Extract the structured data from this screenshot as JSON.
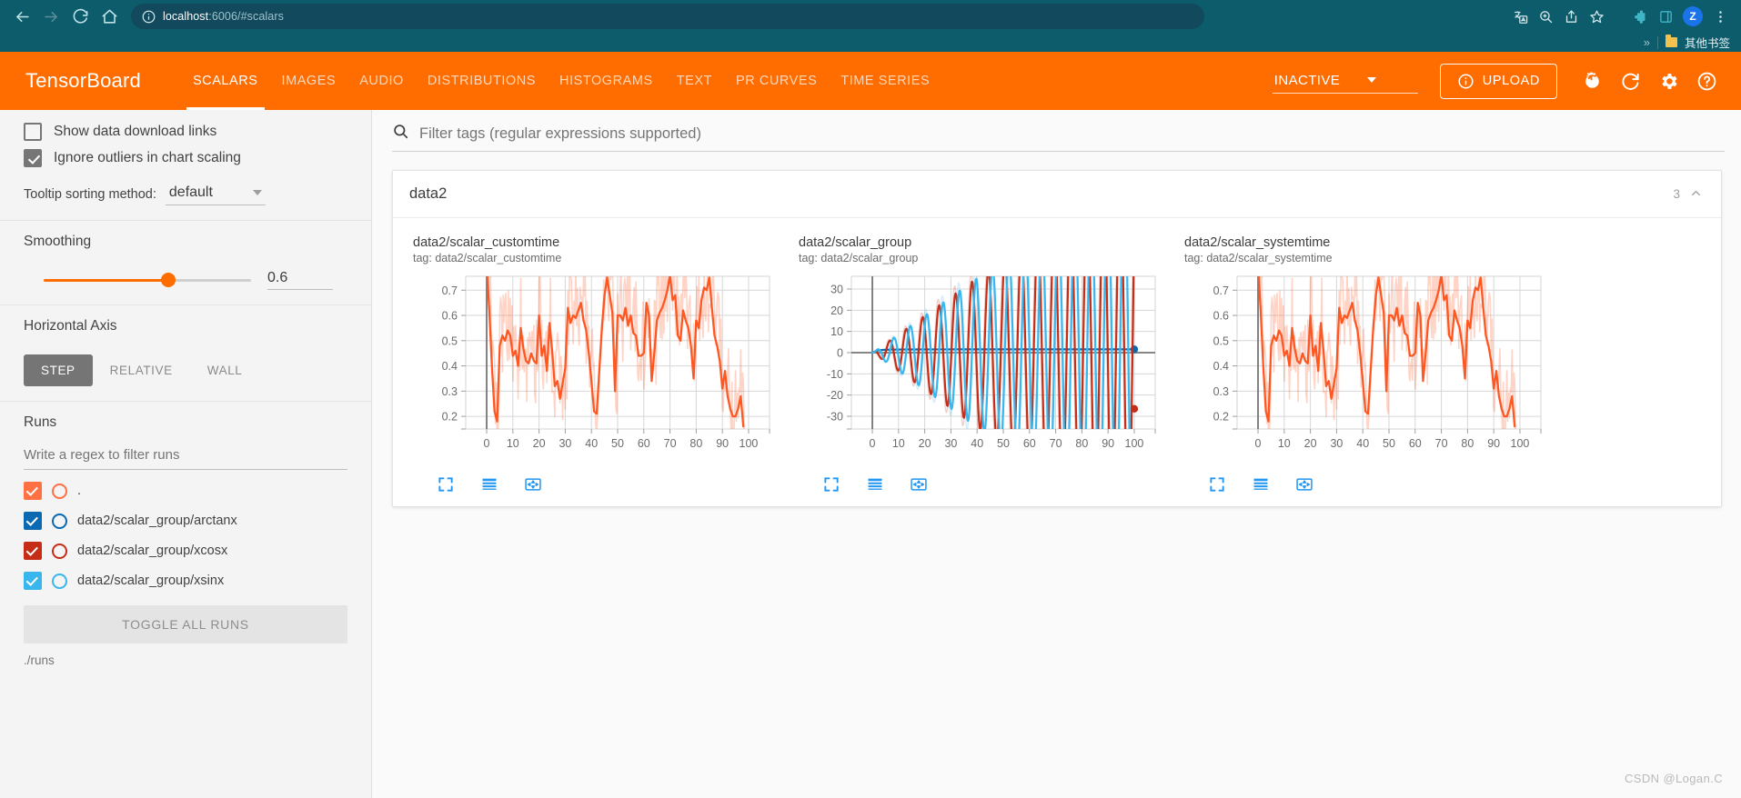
{
  "browser": {
    "url_full": "localhost:6006/#scalars",
    "url_host": "localhost",
    "url_rest": ":6006/#scalars",
    "back_icon": "back-arrow-icon",
    "forward_icon": "forward-arrow-icon",
    "reload_icon": "reload-icon",
    "home_icon": "home-icon",
    "info_icon": "site-info-icon",
    "toolbar_icons": [
      "translate-icon",
      "zoom-icon",
      "share-icon",
      "bookmark-star-icon",
      "extensions-icon",
      "side-panel-icon"
    ],
    "avatar_initial": "Z",
    "menu_icon": "three-dot-menu-icon",
    "bookmarks": {
      "overflow_label": "»",
      "folder_label": "其他书签"
    },
    "chrome_color": "#0d5c6b"
  },
  "tensorboard": {
    "logo": "TensorBoard",
    "accent_color": "#ff6d00",
    "tabs": [
      {
        "label": "SCALARS",
        "active": true
      },
      {
        "label": "IMAGES",
        "active": false
      },
      {
        "label": "AUDIO",
        "active": false
      },
      {
        "label": "DISTRIBUTIONS",
        "active": false
      },
      {
        "label": "HISTOGRAMS",
        "active": false
      },
      {
        "label": "TEXT",
        "active": false
      },
      {
        "label": "PR CURVES",
        "active": false
      },
      {
        "label": "TIME SERIES",
        "active": false
      }
    ],
    "reload_selector_value": "INACTIVE",
    "upload_label": "UPLOAD",
    "header_icons": [
      "brightness-icon",
      "refresh-icon",
      "settings-gear-icon",
      "help-question-icon"
    ]
  },
  "sidebar": {
    "show_download_links": {
      "label": "Show data download links",
      "checked": false
    },
    "ignore_outliers": {
      "label": "Ignore outliers in chart scaling",
      "checked": true
    },
    "tooltip_sorting": {
      "label": "Tooltip sorting method:",
      "value": "default"
    },
    "smoothing": {
      "label": "Smoothing",
      "value": "0.6",
      "percent": 60
    },
    "horizontal_axis": {
      "label": "Horizontal Axis",
      "options": [
        {
          "label": "STEP",
          "active": true
        },
        {
          "label": "RELATIVE",
          "active": false
        },
        {
          "label": "WALL",
          "active": false
        }
      ]
    },
    "runs": {
      "label": "Runs",
      "filter_placeholder": "Write a regex to filter runs",
      "items": [
        {
          "label": ".",
          "color": "#ff7043",
          "checked": true
        },
        {
          "label": "data2/scalar_group/arctanx",
          "color": "#0a69b0",
          "checked": true
        },
        {
          "label": "data2/scalar_group/xcosx",
          "color": "#c62d16",
          "checked": true
        },
        {
          "label": "data2/scalar_group/xsinx",
          "color": "#39b6ee",
          "checked": true
        }
      ],
      "toggle_all_label": "TOGGLE ALL RUNS",
      "path": "./runs"
    }
  },
  "main": {
    "filter_placeholder": "Filter tags (regular expressions supported)",
    "search_icon": "search-icon",
    "card": {
      "title": "data2",
      "count": "3",
      "collapse_icon": "chevron-up-icon"
    },
    "chart_action_icons": [
      "expand-chart-icon",
      "data-table-icon",
      "reset-domain-icon"
    ],
    "watermark": "CSDN @Logan.C"
  },
  "chart_data": [
    {
      "type": "line",
      "title": "data2/scalar_customtime",
      "tag": "tag: data2/scalar_customtime",
      "xlabel": "",
      "ylabel": "",
      "xlim": [
        -8,
        108
      ],
      "ylim": [
        0.15,
        0.755
      ],
      "xticks": [
        0,
        10,
        20,
        30,
        40,
        50,
        60,
        70,
        80,
        90,
        100
      ],
      "yticks": [
        0.2,
        0.3,
        0.4,
        0.5,
        0.6,
        0.7
      ],
      "grid": true,
      "legend": "none",
      "series": [
        {
          "name": ".",
          "color": "#ff5722",
          "smoothed": true,
          "x": [
            0,
            1,
            2,
            3,
            4,
            5,
            6,
            7,
            8,
            9,
            10,
            11,
            12,
            13,
            14,
            15,
            16,
            17,
            18,
            19,
            20,
            21,
            22,
            23,
            24,
            25,
            26,
            27,
            28,
            29,
            30,
            31,
            32,
            33,
            34,
            35,
            36,
            37,
            38,
            39,
            40,
            41,
            42,
            43,
            44,
            45,
            46,
            47,
            48,
            49,
            50,
            51,
            52,
            53,
            54,
            55,
            56,
            57,
            58,
            59,
            60,
            61,
            62,
            63,
            64,
            65,
            66,
            67,
            68,
            69,
            70,
            71,
            72,
            73,
            74,
            75,
            76,
            77,
            78,
            79,
            80,
            81,
            82,
            83,
            84,
            85,
            86,
            87,
            88,
            89,
            90,
            91,
            92,
            93,
            94,
            95,
            96,
            97,
            98
          ],
          "values": [
            0.8,
            0.62,
            0.4,
            0.22,
            0.18,
            0.48,
            0.52,
            0.5,
            0.54,
            0.52,
            0.44,
            0.46,
            0.4,
            0.55,
            0.47,
            0.42,
            0.41,
            0.45,
            0.42,
            0.41,
            0.6,
            0.44,
            0.48,
            0.38,
            0.57,
            0.46,
            0.32,
            0.34,
            0.27,
            0.33,
            0.39,
            0.63,
            0.57,
            0.6,
            0.59,
            0.62,
            0.65,
            0.58,
            0.54,
            0.45,
            0.34,
            0.22,
            0.21,
            0.38,
            0.55,
            0.68,
            0.75,
            0.68,
            0.61,
            0.3,
            0.6,
            0.6,
            0.58,
            0.63,
            0.56,
            0.6,
            0.53,
            0.52,
            0.44,
            0.44,
            0.45,
            0.65,
            0.6,
            0.34,
            0.45,
            0.58,
            0.61,
            0.63,
            0.66,
            0.7,
            0.76,
            0.66,
            0.68,
            0.52,
            0.5,
            0.62,
            0.58,
            0.55,
            0.48,
            0.35,
            0.58,
            0.55,
            0.66,
            0.71,
            0.7,
            0.75,
            0.63,
            0.52,
            0.48,
            0.42,
            0.31,
            0.38,
            0.28,
            0.23,
            0.2,
            0.2,
            0.23,
            0.28,
            0.16
          ]
        }
      ]
    },
    {
      "type": "line",
      "title": "data2/scalar_group",
      "tag": "tag: data2/scalar_group",
      "xlabel": "",
      "ylabel": "",
      "xlim": [
        -8,
        108
      ],
      "ylim": [
        -36,
        36
      ],
      "xticks": [
        0,
        10,
        20,
        30,
        40,
        50,
        60,
        70,
        80,
        90,
        100
      ],
      "yticks": [
        -30,
        -20,
        -10,
        0,
        10,
        20,
        30
      ],
      "grid": true,
      "legend": "none",
      "series": [
        {
          "name": "data2/scalar_group/arctanx",
          "color": "#0a69b0",
          "formula": "arctan(x)",
          "endpoint_marker": true,
          "endpoint": [
            100,
            1.56
          ]
        },
        {
          "name": "data2/scalar_group/xcosx",
          "color": "#c62d16",
          "formula": "x*cos(x)",
          "endpoint_marker": true,
          "endpoint": [
            100,
            -26.5
          ]
        },
        {
          "name": "data2/scalar_group/xsinx",
          "color": "#39b6ee",
          "formula": "x*sin(x)",
          "endpoint_marker": false
        }
      ]
    },
    {
      "type": "line",
      "title": "data2/scalar_systemtime",
      "tag": "tag: data2/scalar_systemtime",
      "xlabel": "",
      "ylabel": "",
      "xlim": [
        -8,
        108
      ],
      "ylim": [
        0.15,
        0.755
      ],
      "xticks": [
        0,
        10,
        20,
        30,
        40,
        50,
        60,
        70,
        80,
        90,
        100
      ],
      "yticks": [
        0.2,
        0.3,
        0.4,
        0.5,
        0.6,
        0.7
      ],
      "grid": true,
      "legend": "none",
      "series": [
        {
          "name": ".",
          "color": "#ff5722",
          "smoothed": true,
          "x": [
            0,
            1,
            2,
            3,
            4,
            5,
            6,
            7,
            8,
            9,
            10,
            11,
            12,
            13,
            14,
            15,
            16,
            17,
            18,
            19,
            20,
            21,
            22,
            23,
            24,
            25,
            26,
            27,
            28,
            29,
            30,
            31,
            32,
            33,
            34,
            35,
            36,
            37,
            38,
            39,
            40,
            41,
            42,
            43,
            44,
            45,
            46,
            47,
            48,
            49,
            50,
            51,
            52,
            53,
            54,
            55,
            56,
            57,
            58,
            59,
            60,
            61,
            62,
            63,
            64,
            65,
            66,
            67,
            68,
            69,
            70,
            71,
            72,
            73,
            74,
            75,
            76,
            77,
            78,
            79,
            80,
            81,
            82,
            83,
            84,
            85,
            86,
            87,
            88,
            89,
            90,
            91,
            92,
            93,
            94,
            95,
            96,
            97,
            98
          ],
          "values": [
            0.8,
            0.62,
            0.4,
            0.22,
            0.18,
            0.48,
            0.52,
            0.5,
            0.54,
            0.52,
            0.44,
            0.46,
            0.4,
            0.55,
            0.47,
            0.42,
            0.41,
            0.45,
            0.42,
            0.41,
            0.6,
            0.44,
            0.48,
            0.38,
            0.57,
            0.46,
            0.32,
            0.34,
            0.27,
            0.33,
            0.39,
            0.63,
            0.57,
            0.6,
            0.59,
            0.62,
            0.65,
            0.58,
            0.54,
            0.45,
            0.34,
            0.22,
            0.21,
            0.38,
            0.55,
            0.68,
            0.75,
            0.68,
            0.61,
            0.3,
            0.6,
            0.6,
            0.58,
            0.63,
            0.56,
            0.6,
            0.53,
            0.52,
            0.44,
            0.44,
            0.45,
            0.65,
            0.6,
            0.34,
            0.45,
            0.58,
            0.61,
            0.63,
            0.66,
            0.7,
            0.76,
            0.66,
            0.68,
            0.52,
            0.5,
            0.62,
            0.58,
            0.55,
            0.48,
            0.35,
            0.58,
            0.55,
            0.66,
            0.71,
            0.7,
            0.75,
            0.63,
            0.52,
            0.48,
            0.42,
            0.31,
            0.38,
            0.28,
            0.23,
            0.2,
            0.2,
            0.23,
            0.28,
            0.16
          ]
        }
      ]
    }
  ]
}
